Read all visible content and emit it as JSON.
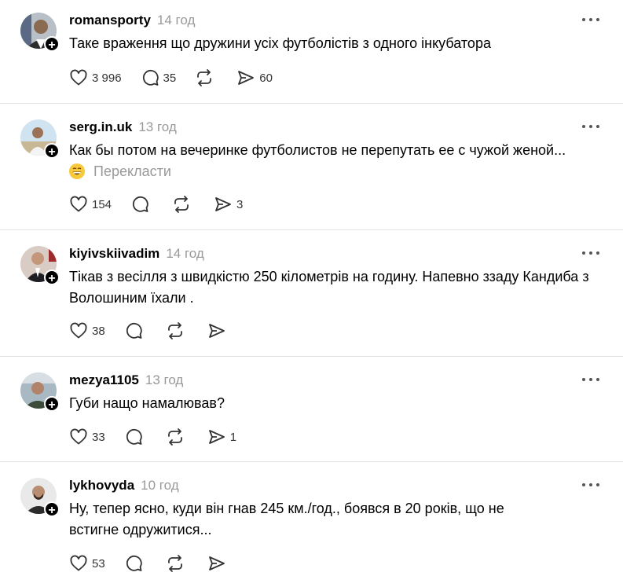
{
  "posts": [
    {
      "username": "romansporty",
      "time": "14 год",
      "text": "Таке враження що дружини усіх футболістів з одного інкубатора",
      "translate": "",
      "likes": "3 996",
      "replies": "35",
      "reposts": "",
      "shares": "60"
    },
    {
      "username": "serg.in.uk",
      "time": "13 год",
      "text": "Как бы потом на вечеринке футболистов не перепутать ее с чужой женой...",
      "translate": "Перекласти",
      "likes": "154",
      "replies": "",
      "reposts": "",
      "shares": "3"
    },
    {
      "username": "kiyivskiivadim",
      "time": "14 год",
      "text": "Тікав з весілля з швидкістю 250 кілометрів на годину. Напевно ззаду Кандиба з Волошиним їхали .",
      "translate": "",
      "likes": "38",
      "replies": "",
      "reposts": "",
      "shares": ""
    },
    {
      "username": "mezya1105",
      "time": "13 год",
      "text": "Губи нащо намалював?",
      "translate": "",
      "likes": "33",
      "replies": "",
      "reposts": "",
      "shares": "1"
    },
    {
      "username": "lykhovyda",
      "time": "10 год",
      "text": "Ну, тепер ясно, куди він гнав 245 км./год., боявся в 20 років, що не встигне одружитися...",
      "translate": "",
      "likes": "53",
      "replies": "",
      "reposts": "",
      "shares": ""
    }
  ],
  "icons": {
    "like": "heart-icon",
    "reply": "comment-icon",
    "repost": "repost-icon",
    "share": "send-icon",
    "more": "more-icon",
    "follow": "plus-icon"
  },
  "follow_symbol": "+"
}
